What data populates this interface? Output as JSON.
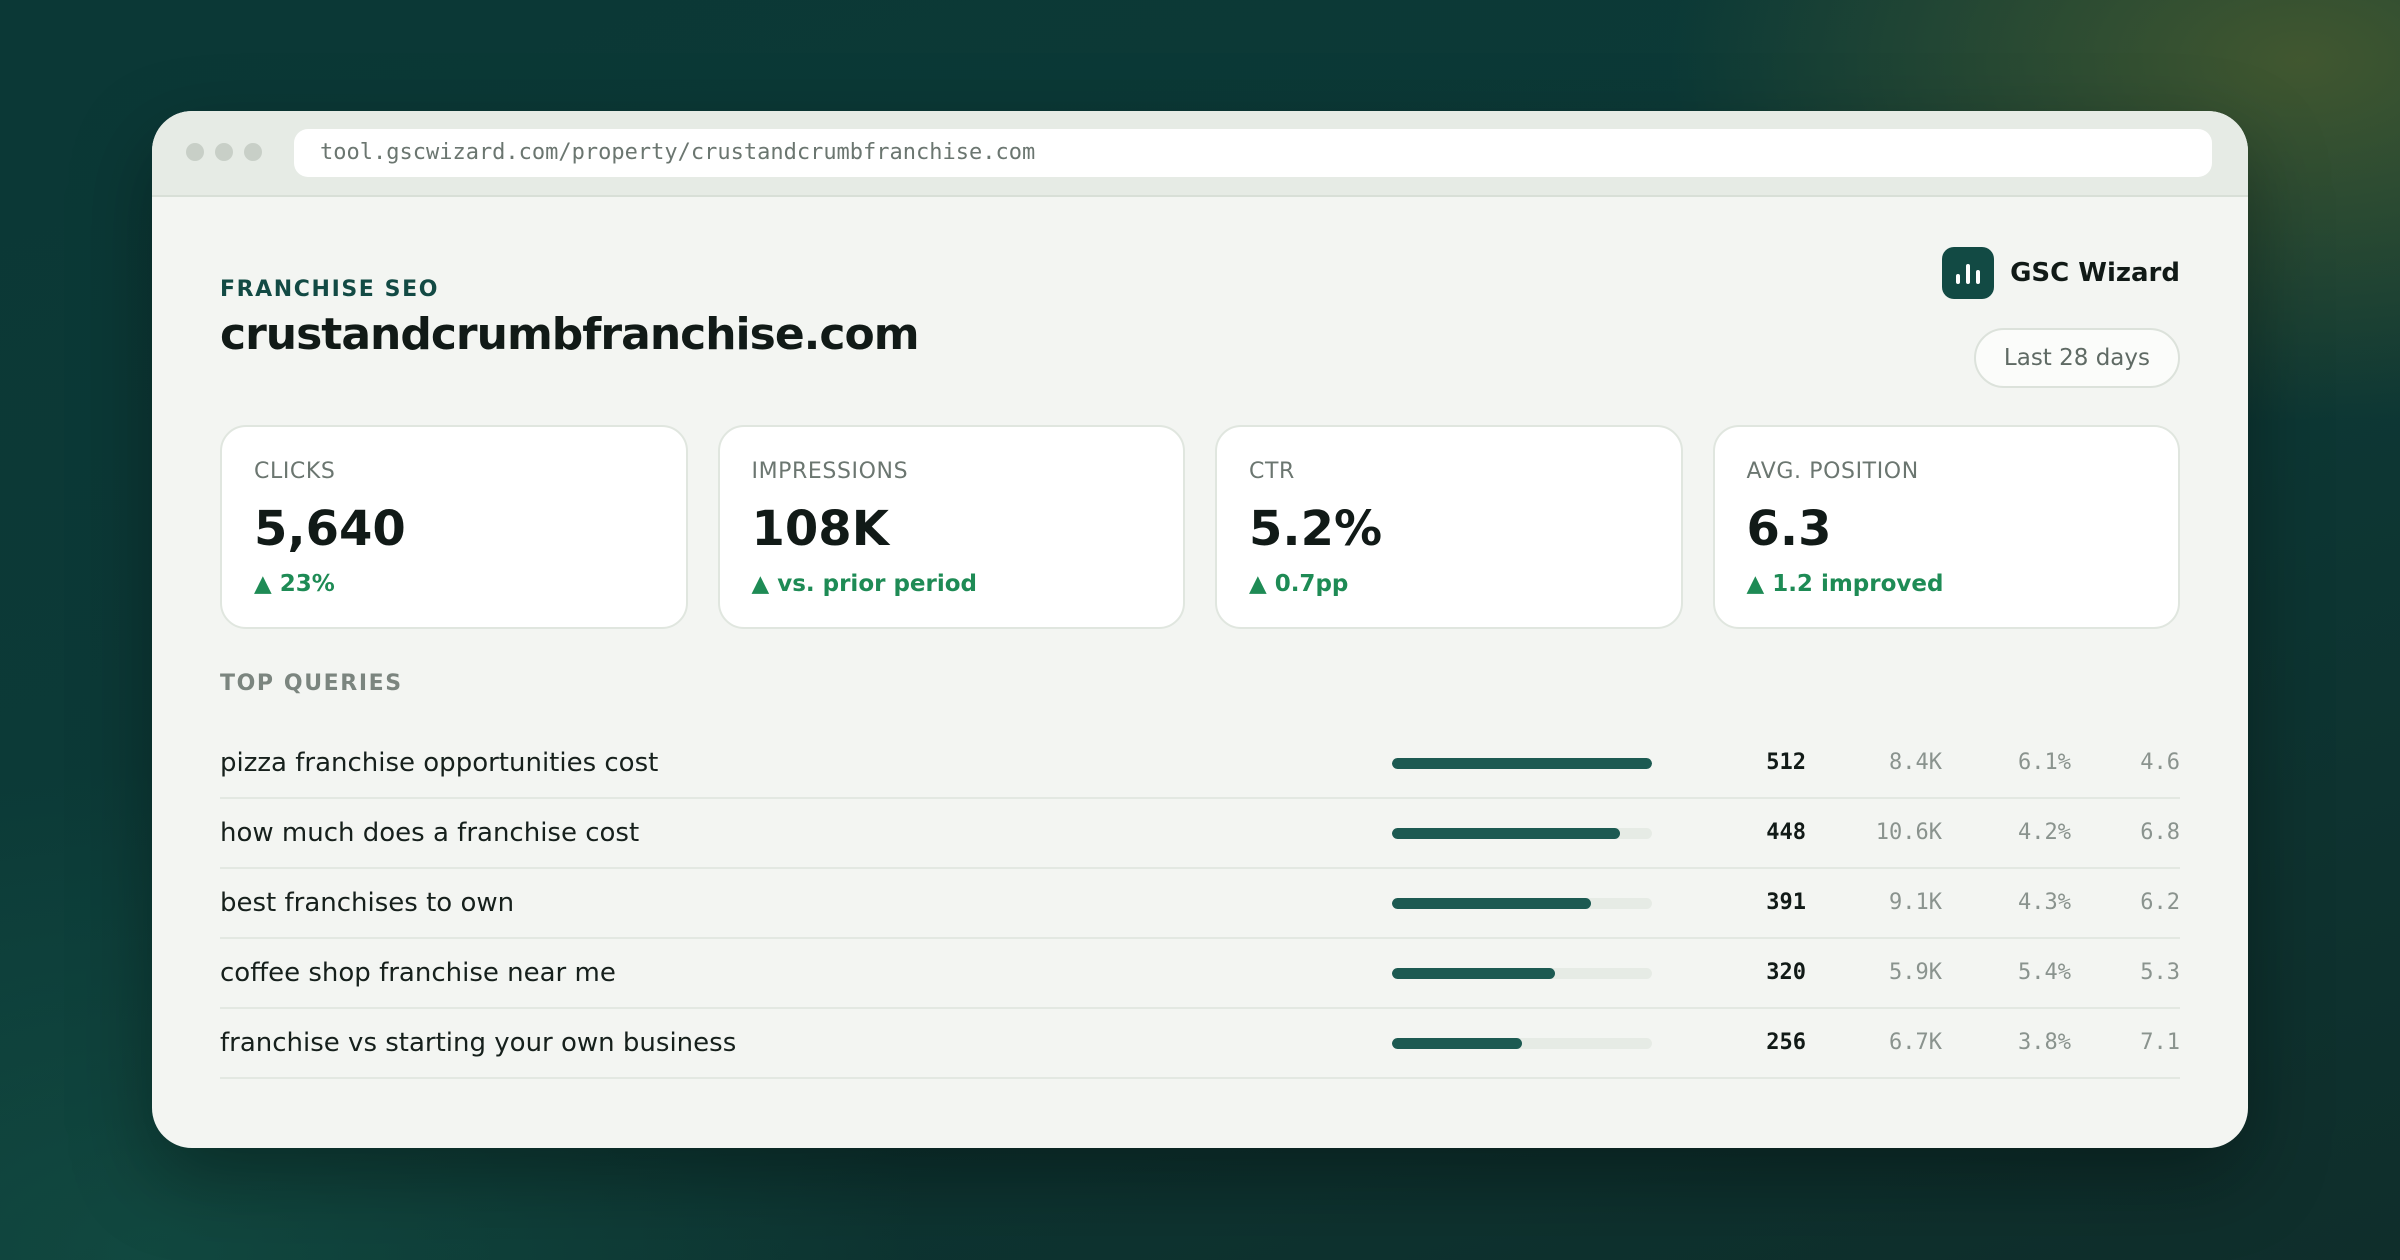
{
  "browser": {
    "url": "tool.gscwizard.com/property/crustandcrumbfranchise.com"
  },
  "header": {
    "eyebrow": "FRANCHISE SEO",
    "title": "crustandcrumbfranchise.com",
    "brand": "GSC Wizard",
    "range": "Last 28 days"
  },
  "metrics": [
    {
      "label": "CLICKS",
      "value": "5,640",
      "delta": "▲ 23%"
    },
    {
      "label": "IMPRESSIONS",
      "value": "108K",
      "delta": "▲ vs. prior period"
    },
    {
      "label": "CTR",
      "value": "5.2%",
      "delta": "▲ 0.7pp"
    },
    {
      "label": "AVG. POSITION",
      "value": "6.3",
      "delta": "▲ 1.2 improved"
    }
  ],
  "top_queries": {
    "label": "TOP QUERIES",
    "rows": [
      {
        "query": "pizza franchise opportunities cost",
        "clicks": "512",
        "impressions": "8.4K",
        "ctr": "6.1%",
        "position": "4.6",
        "bar_fraction": 1.0
      },
      {
        "query": "how much does a franchise cost",
        "clicks": "448",
        "impressions": "10.6K",
        "ctr": "4.2%",
        "position": "6.8",
        "bar_fraction": 0.875
      },
      {
        "query": "best franchises to own",
        "clicks": "391",
        "impressions": "9.1K",
        "ctr": "4.3%",
        "position": "6.2",
        "bar_fraction": 0.764
      },
      {
        "query": "coffee shop franchise near me",
        "clicks": "320",
        "impressions": "5.9K",
        "ctr": "5.4%",
        "position": "5.3",
        "bar_fraction": 0.625
      },
      {
        "query": "franchise vs starting your own business",
        "clicks": "256",
        "impressions": "6.7K",
        "ctr": "3.8%",
        "position": "7.1",
        "bar_fraction": 0.5
      }
    ]
  },
  "colors": {
    "accent": "#124a44",
    "positive": "#1e8b55",
    "bar": "#1c5a52"
  }
}
